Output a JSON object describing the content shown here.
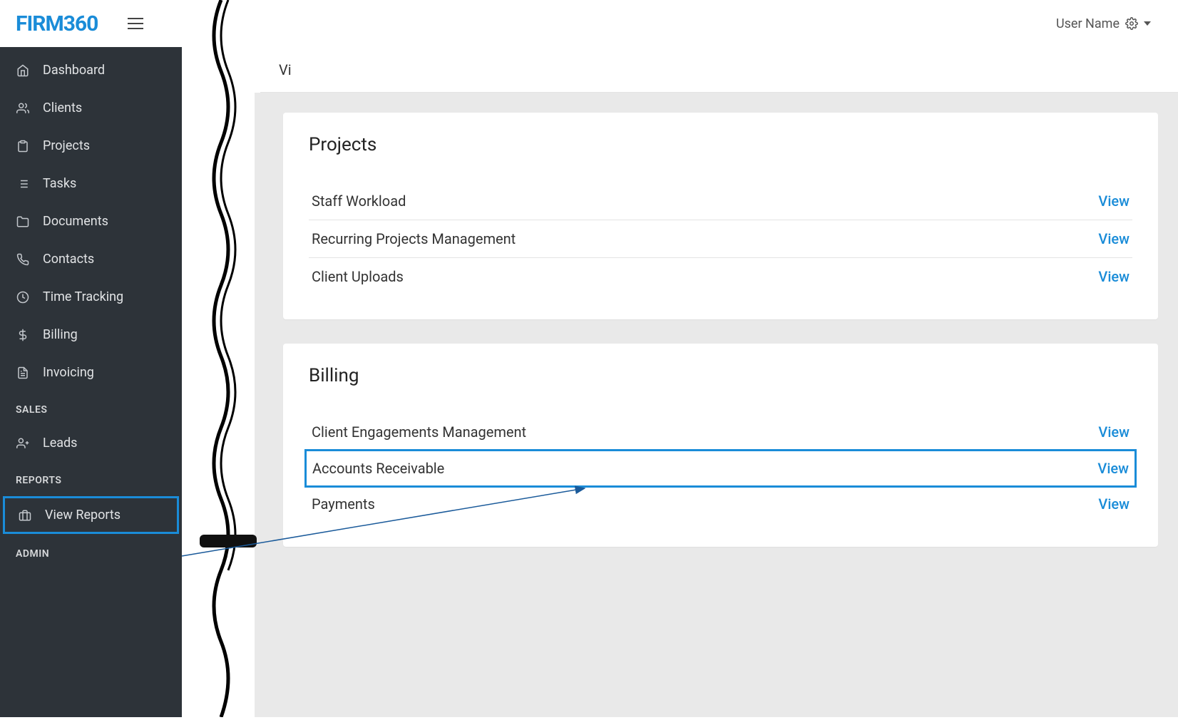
{
  "header": {
    "logo": "FIRM360",
    "user_label": "User Name"
  },
  "sidebar": {
    "items": [
      {
        "icon": "home",
        "label": "Dashboard"
      },
      {
        "icon": "users",
        "label": "Clients"
      },
      {
        "icon": "clipboard",
        "label": "Projects"
      },
      {
        "icon": "list",
        "label": "Tasks"
      },
      {
        "icon": "folder",
        "label": "Documents"
      },
      {
        "icon": "phone",
        "label": "Contacts"
      },
      {
        "icon": "clock",
        "label": "Time Tracking"
      },
      {
        "icon": "dollar",
        "label": "Billing"
      },
      {
        "icon": "file",
        "label": "Invoicing"
      }
    ],
    "sales_label": "SALES",
    "leads_label": "Leads",
    "reports_label": "REPORTS",
    "view_reports_label": "View Reports",
    "admin_label": "ADMIN"
  },
  "breadcrumb_prefix": "Vi",
  "cards": [
    {
      "title": "Projects",
      "rows": [
        {
          "label": "Staff Workload",
          "action": "View"
        },
        {
          "label": "Recurring Projects Management",
          "action": "View"
        },
        {
          "label": "Client Uploads",
          "action": "View"
        }
      ]
    },
    {
      "title": "Billing",
      "rows": [
        {
          "label": "Client Engagements Management",
          "action": "View"
        },
        {
          "label": "Accounts Receivable",
          "action": "View",
          "highlight": true
        },
        {
          "label": "Payments",
          "action": "View"
        }
      ]
    }
  ]
}
